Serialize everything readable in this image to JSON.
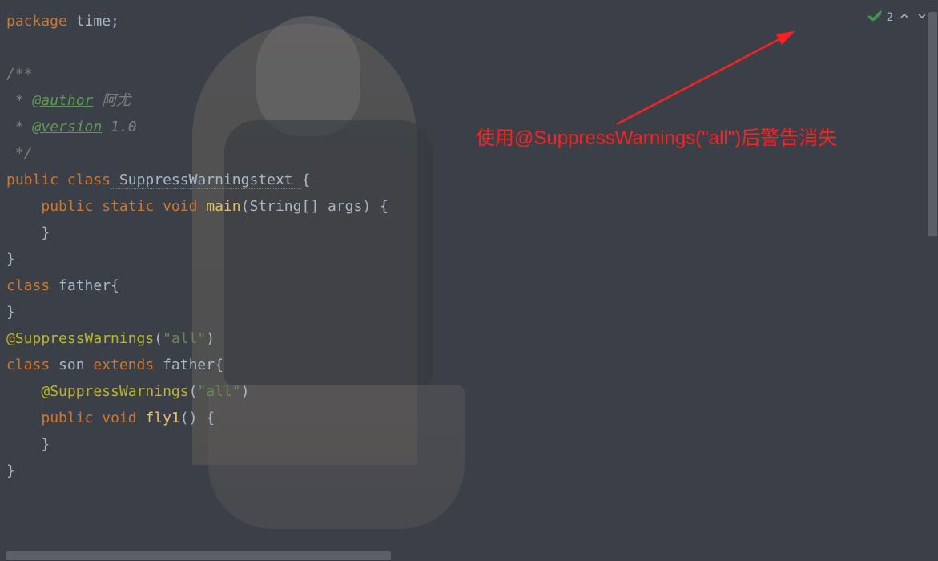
{
  "code": {
    "line1_kw": "package",
    "line1_pkg": " time",
    "line1_semi": ";",
    "line3": "/**",
    "line4_star": " * ",
    "line4_tag": "@author",
    "line4_name": " 阿尤",
    "line5_star": " * ",
    "line5_tag": "@version",
    "line5_ver": " 1.0",
    "line6": " */",
    "line7_kw1": "public",
    "line7_kw2": " class",
    "line7_name": " SuppressWarningstext ",
    "line7_brace": "{",
    "line8_indent": "    ",
    "line8_kw1": "public",
    "line8_kw2": " static",
    "line8_kw3": " void",
    "line8_method": " main",
    "line8_params": "(String[] args) ",
    "line8_brace": "{",
    "line9": "    }",
    "line10": "}",
    "line11_kw": "class",
    "line11_name": " father",
    "line11_brace": "{",
    "line12": "}",
    "line13_anno": "@SuppressWarnings",
    "line13_paren1": "(",
    "line13_str": "\"all\"",
    "line13_paren2": ")",
    "line14_kw1": "class",
    "line14_name": " son ",
    "line14_kw2": "extends",
    "line14_parent": " father",
    "line14_brace": "{",
    "line15_indent": "    ",
    "line15_anno": "@SuppressWarnings",
    "line15_paren1": "(",
    "line15_str": "\"all\"",
    "line15_paren2": ")",
    "line16_indent": "    ",
    "line16_kw1": "public",
    "line16_kw2": " void",
    "line16_method": " fly1",
    "line16_params": "() ",
    "line16_brace": "{",
    "line17": "    }",
    "line18": "}"
  },
  "topbar": {
    "count": "2"
  },
  "annotation": {
    "text": "使用@SuppressWarnings(\"all\")后警告消失"
  }
}
